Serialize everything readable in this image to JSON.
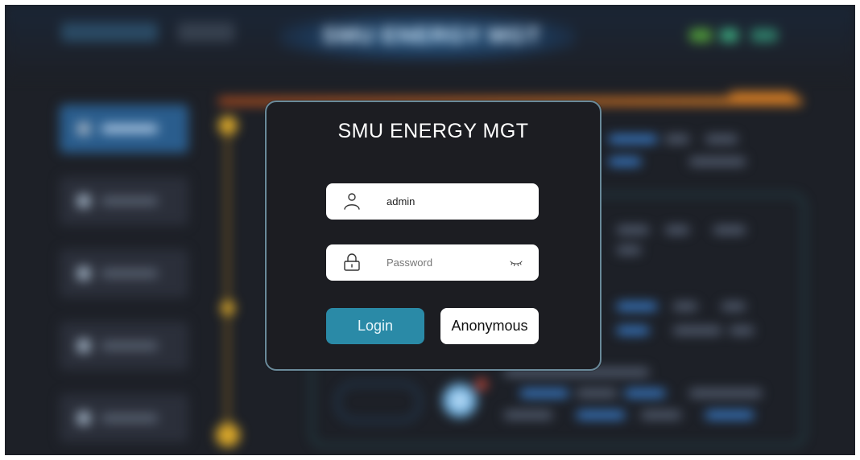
{
  "background": {
    "title": "SMU ENERGY MGT",
    "note": ""
  },
  "dialog": {
    "title": "SMU ENERGY MGT",
    "username": {
      "value": "admin",
      "placeholder": "",
      "icon": "user-icon"
    },
    "password": {
      "value": "",
      "placeholder": "Password",
      "icon": "lock-icon",
      "toggle_icon": "eye-closed-icon"
    },
    "login_label": "Login",
    "anonymous_label": "Anonymous"
  },
  "colors": {
    "login_button": "#2a8aa7",
    "dialog_border": "#6a8a9a",
    "dialog_bg": "#1c1d22"
  }
}
